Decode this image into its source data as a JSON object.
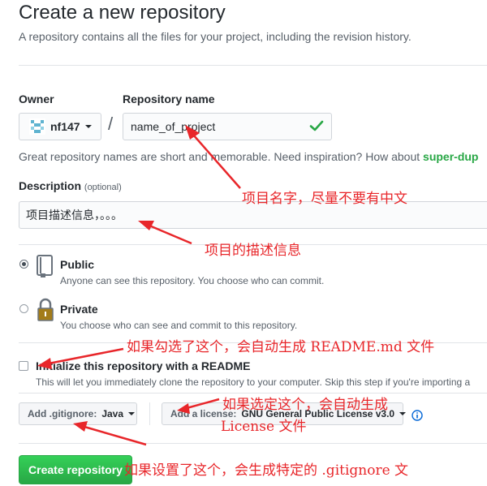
{
  "page": {
    "title": "Create a new repository",
    "subtitle": "A repository contains all the files for your project, including the revision history."
  },
  "owner": {
    "label": "Owner",
    "value": "nf147"
  },
  "repo": {
    "label": "Repository name",
    "value": "name_of_project"
  },
  "hint": {
    "text": "Great repository names are short and memorable. Need inspiration? How about ",
    "suggestion": "super-dup"
  },
  "description": {
    "label": "Description",
    "optional": "(optional)",
    "value": "项目描述信息，。。。"
  },
  "visibility": [
    {
      "title": "Public",
      "note": "Anyone can see this repository. You choose who can commit.",
      "checked": true
    },
    {
      "title": "Private",
      "note": "You choose who can see and commit to this repository.",
      "checked": false
    }
  ],
  "readme": {
    "label": "Initialize this repository with a README",
    "note": "This will let you immediately clone the repository to your computer. Skip this step if you're importing a",
    "checked": false
  },
  "gitignore": {
    "prefix": "Add .gitignore:",
    "value": "Java"
  },
  "license": {
    "prefix": "Add a license:",
    "value": "GNU General Public License v3.0"
  },
  "submit": {
    "label": "Create repository"
  },
  "annotations": [
    "项目名字，尽量不要有中文",
    "项目的描述信息",
    "如果勾选了这个，会自动生成 README.md 文件",
    "如果选定这个，会自动生成",
    "License 文件",
    "如果设置了这个，会生成特定的 .gitignore 文"
  ],
  "colors": {
    "accent_green": "#28a745",
    "annotation_red": "#e8262a",
    "check_green": "#28a745"
  }
}
